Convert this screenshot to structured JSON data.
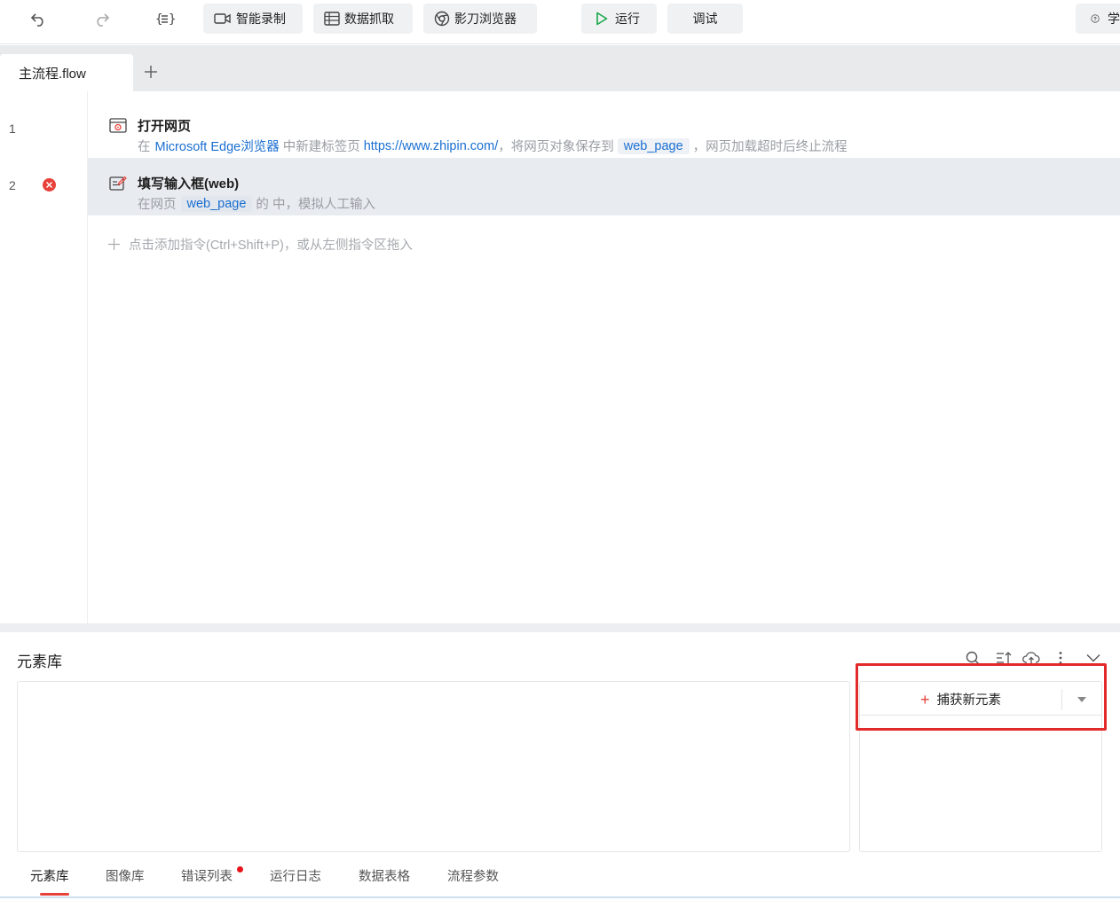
{
  "toolbar": {
    "smart_record": "智能录制",
    "data_scrape": "数据抓取",
    "browser": "影刀浏览器",
    "run": "运行",
    "debug": "调试",
    "help_partial": "学"
  },
  "tabs": {
    "active": "主流程.flow"
  },
  "flow": {
    "steps": [
      {
        "line": "1",
        "title": "打开网页",
        "desc": {
          "p1": "在",
          "browser": "Microsoft Edge浏览器",
          "p2": "中新建标签页",
          "url": "https://www.zhipin.com/",
          "p3": "，将网页对象保存到",
          "var": "web_page",
          "p4": "，网页加载超时后终止流程"
        }
      },
      {
        "line": "2",
        "title": "填写输入框(web)",
        "desc": {
          "p1": "在网页",
          "var": "web_page",
          "p2": "的 中，模拟人工输入"
        }
      }
    ],
    "add_hint": "点击添加指令(Ctrl+Shift+P)，或从左侧指令区拖入"
  },
  "panel": {
    "title": "元素库",
    "capture_label": "捕获新元素"
  },
  "bottom_tabs": [
    "元素库",
    "图像库",
    "错误列表",
    "运行日志",
    "数据表格",
    "流程参数"
  ],
  "colors": {
    "accent_red": "#e8413a",
    "link_blue": "#1a6fd1",
    "highlight_red": "#e22a2a"
  }
}
